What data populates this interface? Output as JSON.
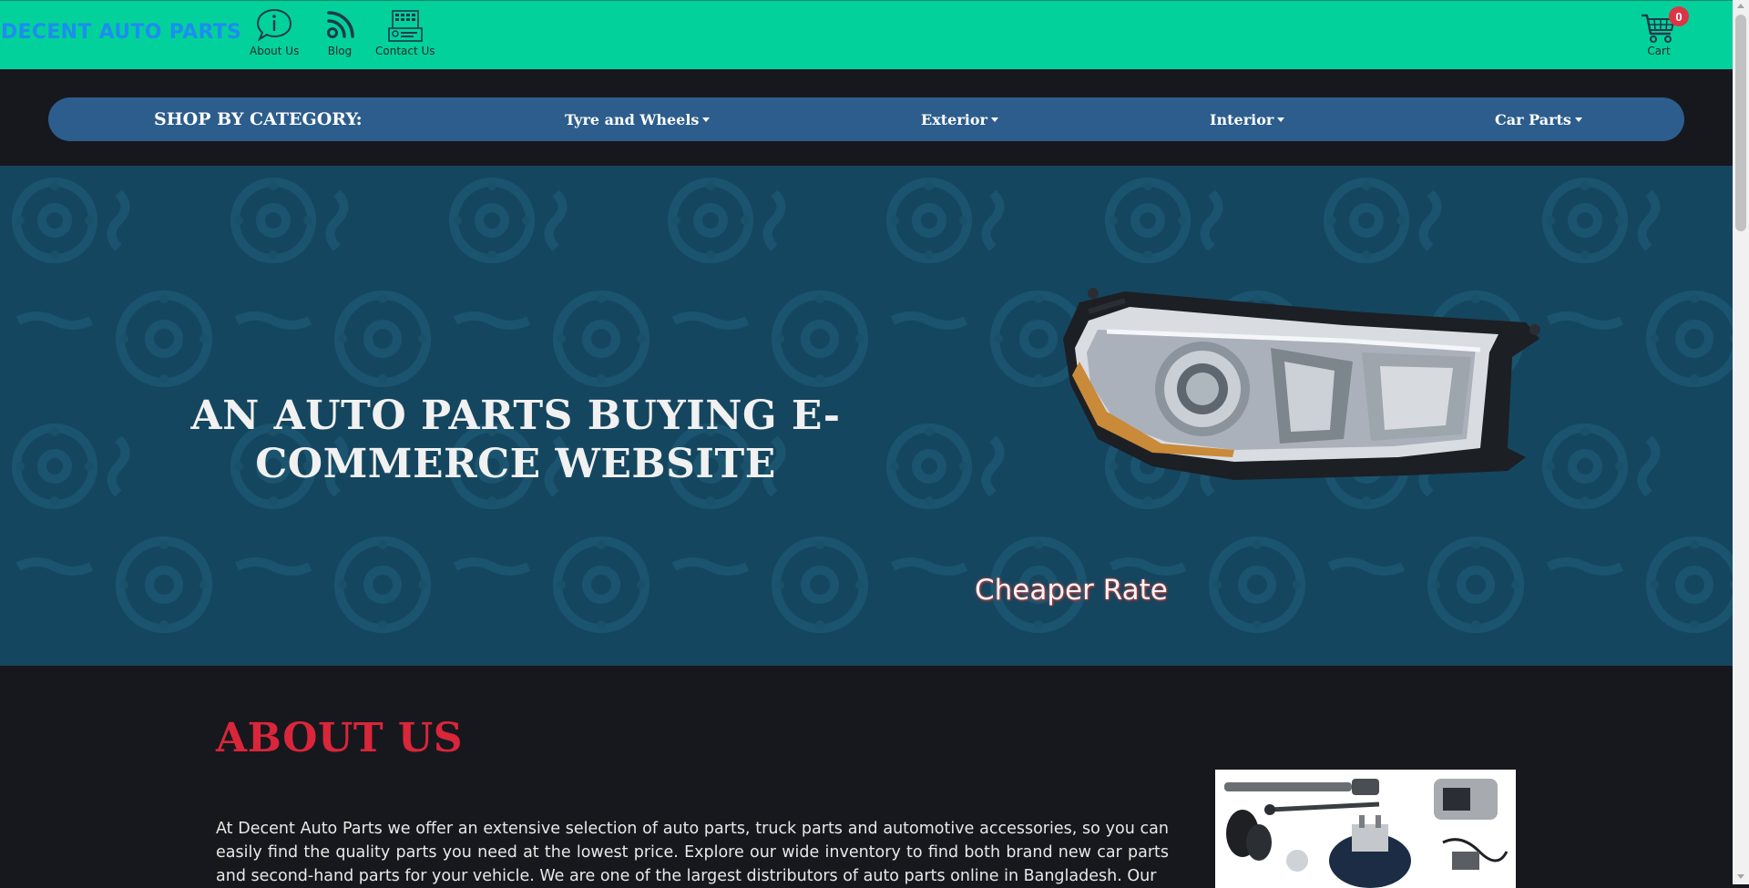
{
  "header": {
    "brand": "DECENT AUTO PARTS",
    "nav": [
      {
        "label": "About Us",
        "icon": "info-bubble-icon"
      },
      {
        "label": "Blog",
        "icon": "rss-icon"
      },
      {
        "label": "Contact Us",
        "icon": "contact-card-icon"
      }
    ],
    "cart": {
      "label": "Cart",
      "count": "0",
      "icon": "shopping-cart-icon"
    },
    "bg_color": "#03d19c"
  },
  "categories": {
    "heading": "SHOP BY CATEGORY:",
    "items": [
      {
        "label": "Tyre and Wheels"
      },
      {
        "label": "Exterior"
      },
      {
        "label": "Interior"
      },
      {
        "label": "Car Parts"
      }
    ],
    "bg_color": "#2c5d8c"
  },
  "hero": {
    "title": "AN AUTO PARTS BUYING E-COMMERCE WEBSITE",
    "caption": "Cheaper Rate",
    "bg_color": "#15465f"
  },
  "about": {
    "title": "ABOUT US",
    "text": "At Decent Auto Parts we offer an extensive selection of auto parts, truck parts and automotive accessories, so you can easily find the quality parts you need at the lowest price. Explore our wide inventory to find both brand new car parts and second-hand parts for your vehicle. We are one of the largest distributors of auto parts online in Bangladesh. Our",
    "accent_color": "#d9263a"
  }
}
